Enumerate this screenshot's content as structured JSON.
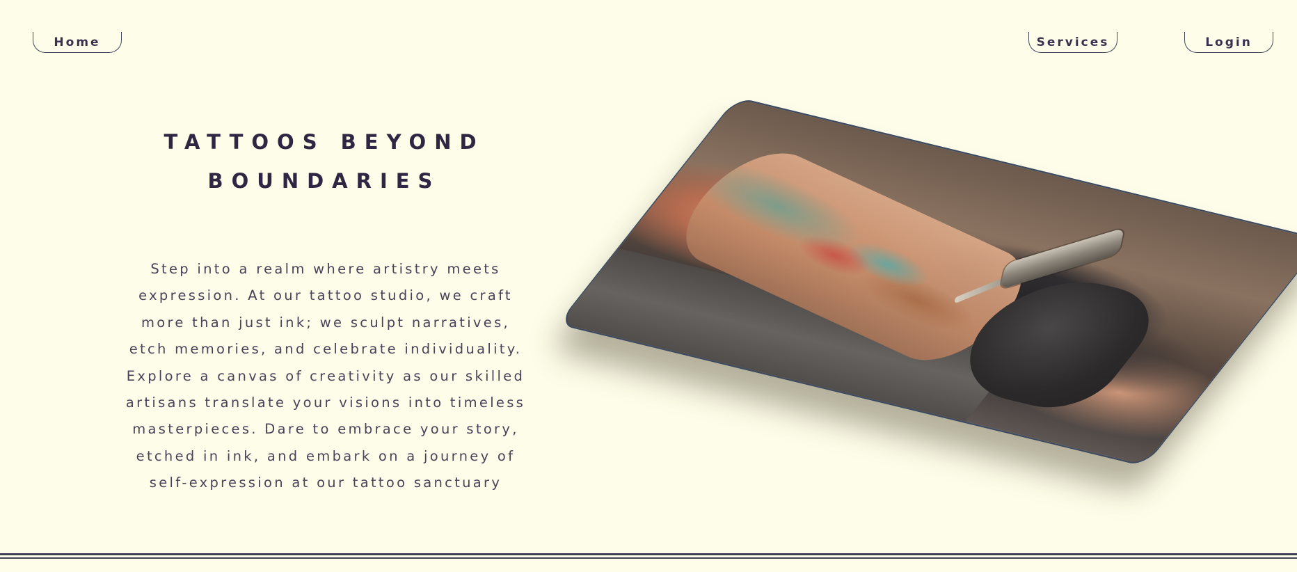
{
  "nav": {
    "home_label": "Home",
    "services_label": "Services",
    "login_label": "Login"
  },
  "hero": {
    "title": "TATTOOS BEYOND BOUNDARIES",
    "description": "Step into a realm where artistry meets expression. At our tattoo studio, we craft more than just ink; we sculpt narratives, etch memories, and celebrate individuality. Explore a canvas of creativity as our skilled artisans translate your visions into timeless masterpieces. Dare to embrace your story, etched in ink, and embark on a journey of self-expression at our tattoo sanctuary"
  },
  "colors": {
    "background": "#fdfde9",
    "accent": "#3d4257",
    "title_text": "#2e2642",
    "body_text": "#4a4258"
  }
}
